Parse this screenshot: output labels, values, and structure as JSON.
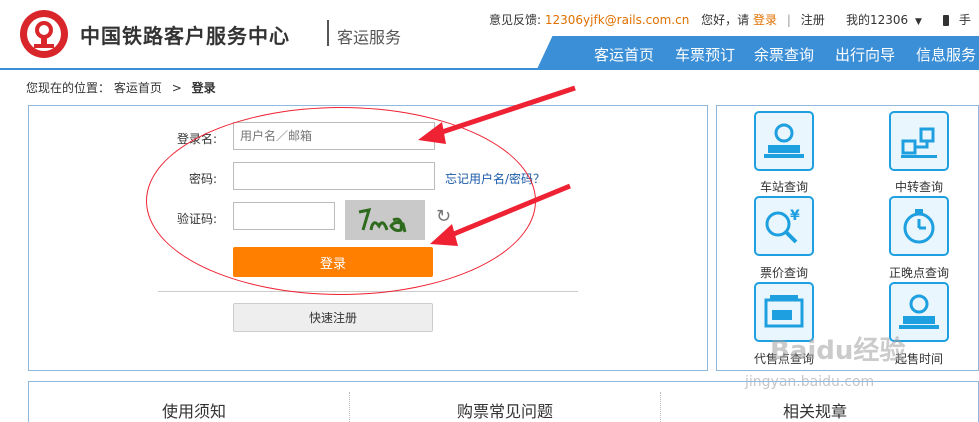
{
  "header": {
    "site_title": "中国铁路客户服务中心",
    "section_title": "客运服务",
    "feedback_label": "意见反馈:",
    "feedback_email": "12306yjfk@rails.com.cn",
    "greeting": "您好，请",
    "login_link": "登录",
    "register_link": "注册",
    "my12306": "我的12306",
    "mobile": "手"
  },
  "nav": {
    "items": [
      "客运首页",
      "车票预订",
      "余票查询",
      "出行向导",
      "信息服务"
    ]
  },
  "breadcrumb": {
    "prefix": "您现在的位置：",
    "home": "客运首页",
    "arrow": ">",
    "current": "登录"
  },
  "login": {
    "username_label": "登录名:",
    "username_placeholder": "用户名／邮箱",
    "password_label": "密码:",
    "forgot_link": "忘记用户名/密码？",
    "captcha_label": "验证码:",
    "captcha_text": "7ma",
    "submit_label": "登录",
    "quick_register_label": "快速注册"
  },
  "quick_links": [
    {
      "label": "车站查询",
      "icon": "station-icon"
    },
    {
      "label": "中转查询",
      "icon": "transfer-icon"
    },
    {
      "label": "票价查询",
      "icon": "price-search-icon"
    },
    {
      "label": "正晚点查询",
      "icon": "clock-icon"
    },
    {
      "label": "代售点查询",
      "icon": "ticket-agent-icon"
    },
    {
      "label": "起售时间",
      "icon": "station-icon"
    }
  ],
  "bottom_tabs": [
    "使用须知",
    "购票常见问题",
    "相关规章"
  ],
  "watermark": {
    "text": "Baidu经验",
    "url": "jingyan.baidu.com"
  },
  "colors": {
    "brand_red": "#d8262b",
    "nav_blue": "#3b8fd6",
    "accent_orange": "#ff7f00",
    "link_blue": "#1a5aa8",
    "tile_blue": "#1ea0e0",
    "annotation_red": "#e23"
  }
}
